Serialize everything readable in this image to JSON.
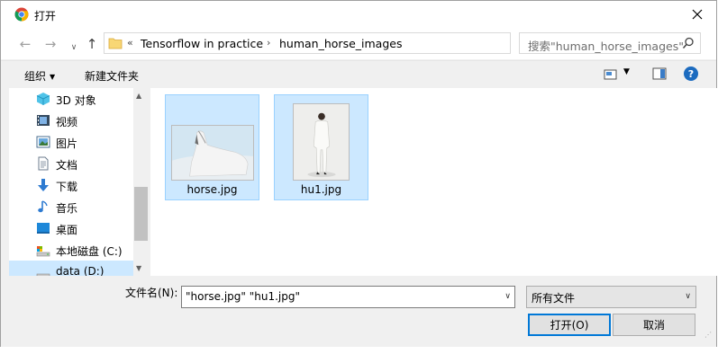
{
  "window": {
    "title": "打开"
  },
  "nav": {
    "back": "←",
    "forward": "→",
    "up": "↑",
    "history": "∨"
  },
  "address": {
    "chevron": "«",
    "crumbs": [
      "Tensorflow in practice",
      "human_horse_images"
    ],
    "separator": "›"
  },
  "search": {
    "placeholder": "搜索\"human_horse_images\""
  },
  "toolbar": {
    "organize": "组织",
    "new_folder": "新建文件夹",
    "help": "?"
  },
  "sidebar": {
    "items": [
      {
        "label": "3D 对象",
        "icon": "3d-objects-icon"
      },
      {
        "label": "视频",
        "icon": "video-icon"
      },
      {
        "label": "图片",
        "icon": "pictures-icon"
      },
      {
        "label": "文档",
        "icon": "documents-icon"
      },
      {
        "label": "下载",
        "icon": "download-icon"
      },
      {
        "label": "音乐",
        "icon": "music-icon"
      },
      {
        "label": "桌面",
        "icon": "desktop-icon"
      },
      {
        "label": "本地磁盘 (C:)",
        "icon": "local-disk-icon"
      },
      {
        "label": "data (D:)",
        "icon": "drive-icon"
      }
    ]
  },
  "files": [
    {
      "name": "horse.jpg",
      "selected": true
    },
    {
      "name": "hu1.jpg",
      "selected": true
    }
  ],
  "footer": {
    "filename_label": "文件名(N):",
    "filename_value": "\"horse.jpg\" \"hu1.jpg\"",
    "filetype_value": "所有文件",
    "open_button": "打开(O)",
    "cancel_button": "取消"
  },
  "colors": {
    "selection": "#cce8ff",
    "accent": "#0078d7",
    "help": "#1c6bbf"
  }
}
